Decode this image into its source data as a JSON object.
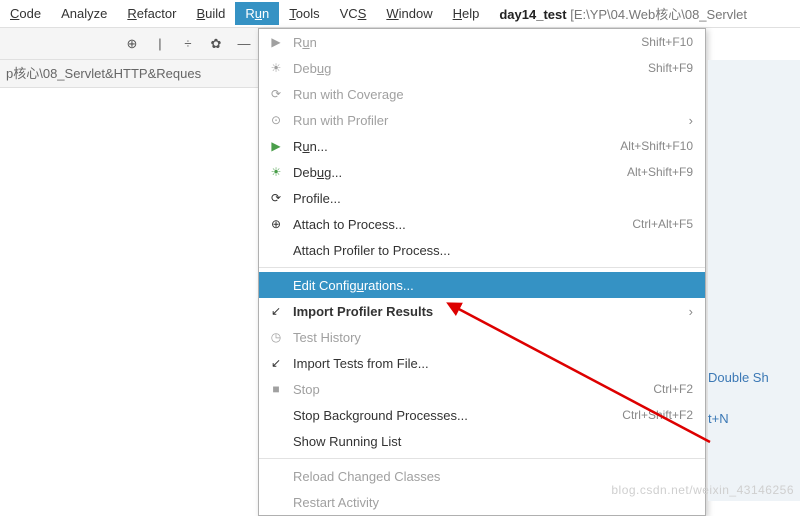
{
  "menubar": {
    "items": [
      {
        "label": "Code",
        "u": 0
      },
      {
        "label": "Analyze",
        "u": -1
      },
      {
        "label": "Refactor",
        "u": 0
      },
      {
        "label": "Build",
        "u": 0
      },
      {
        "label": "Run",
        "u": 1,
        "active": true
      },
      {
        "label": "Tools",
        "u": 0
      },
      {
        "label": "VCS",
        "u": 2
      },
      {
        "label": "Window",
        "u": 0
      },
      {
        "label": "Help",
        "u": 0
      }
    ],
    "project_name": "day14_test",
    "project_path": "[E:\\YP\\04.Web核心\\08_Servlet"
  },
  "path_row": "p核心\\08_Servlet&HTTP&Reques",
  "dropdown": [
    {
      "icon": "▶",
      "label": "Run",
      "short": "Shift+F10",
      "disabled": true
    },
    {
      "icon": "☀",
      "label": "Debug",
      "short": "Shift+F9",
      "disabled": true
    },
    {
      "icon": "⟳",
      "label": "Run with Coverage",
      "disabled": true
    },
    {
      "icon": "⊙",
      "label": "Run with Profiler",
      "sub": "›",
      "disabled": true
    },
    {
      "icon": "▶",
      "label": "Run...",
      "short": "Alt+Shift+F10",
      "green": true
    },
    {
      "icon": "☀",
      "label": "Debug...",
      "short": "Alt+Shift+F9",
      "green": true
    },
    {
      "icon": "⟳",
      "label": "Profile..."
    },
    {
      "icon": "⊕",
      "label": "Attach to Process...",
      "short": "Ctrl+Alt+F5"
    },
    {
      "label": "Attach Profiler to Process..."
    },
    {
      "sep": true
    },
    {
      "label": "Edit Configurations...",
      "selected": true
    },
    {
      "icon": "↙",
      "label": "Import Profiler Results",
      "sub": "›",
      "bold": true
    },
    {
      "icon": "◷",
      "label": "Test History",
      "disabled": true
    },
    {
      "icon": "↙",
      "label": "Import Tests from File..."
    },
    {
      "icon": "■",
      "label": "Stop",
      "short": "Ctrl+F2",
      "disabled": true
    },
    {
      "label": "Stop Background Processes...",
      "short": "Ctrl+Shift+F2"
    },
    {
      "label": "Show Running List"
    },
    {
      "sep": true
    },
    {
      "label": "Reload Changed Classes",
      "disabled": true
    },
    {
      "label": "Restart Activity",
      "disabled": true
    }
  ],
  "right_labels": {
    "l1": "Double Sh",
    "l2": "t+N"
  },
  "watermark": "blog.csdn.net/weixin_43146256"
}
